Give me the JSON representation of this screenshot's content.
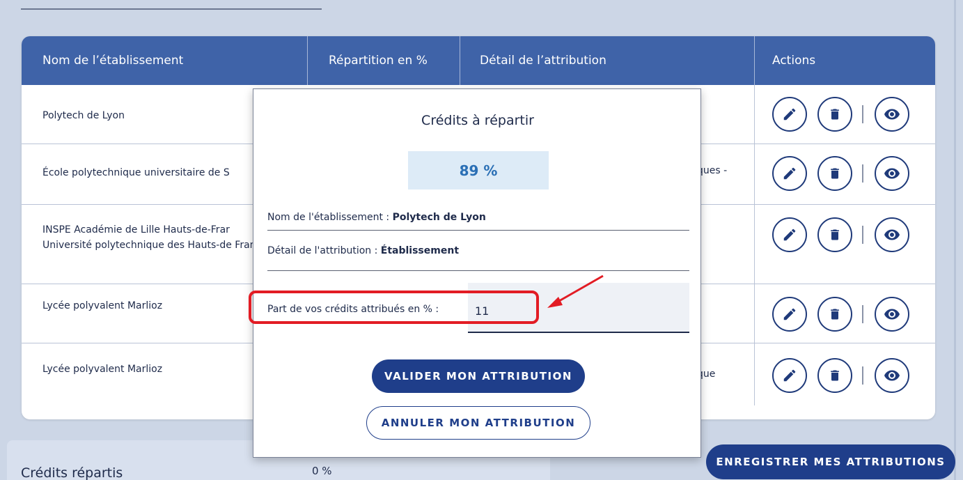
{
  "table": {
    "headers": {
      "name": "Nom de l’établissement",
      "repartition": "Répartition en %",
      "detail": "Détail de l’attribution",
      "actions": "Actions"
    },
    "rows": [
      {
        "name": "Polytech de Lyon",
        "detail": ""
      },
      {
        "name": "École polytechnique universitaire de S",
        "detail": "ques -"
      },
      {
        "name": "INSPE Académie de Lille Hauts-de-Frar Université polytechnique des Hauts-de France",
        "detail": ""
      },
      {
        "name": "Lycée polyvalent Marlioz",
        "detail": ""
      },
      {
        "name": "Lycée polyvalent Marlioz",
        "detail": "que"
      }
    ],
    "action_icons": [
      "pencil-icon",
      "trash-icon",
      "eye-icon"
    ]
  },
  "bottom": {
    "credits_label": "Crédits répartis",
    "credits_value": "0 %",
    "save_button": "ENREGISTRER MES ATTRIBUTIONS"
  },
  "modal": {
    "title": "Crédits à répartir",
    "percentage": "89 %",
    "name_label": "Nom de l'établissement : ",
    "name_value": "Polytech de Lyon",
    "detail_label": "Détail de l'attribution : ",
    "detail_value": "Établissement",
    "part_label": "Part de vos crédits attribués en % :",
    "part_value": "11",
    "validate_button": "VALIDER MON ATTRIBUTION",
    "cancel_button": "ANNULER MON ATTRIBUTION"
  },
  "colors": {
    "header_blue": "#3f63a8",
    "primary_navy": "#1f3e8a",
    "highlight_red": "#e21c24",
    "percentage_blue": "#2a6fb5"
  }
}
